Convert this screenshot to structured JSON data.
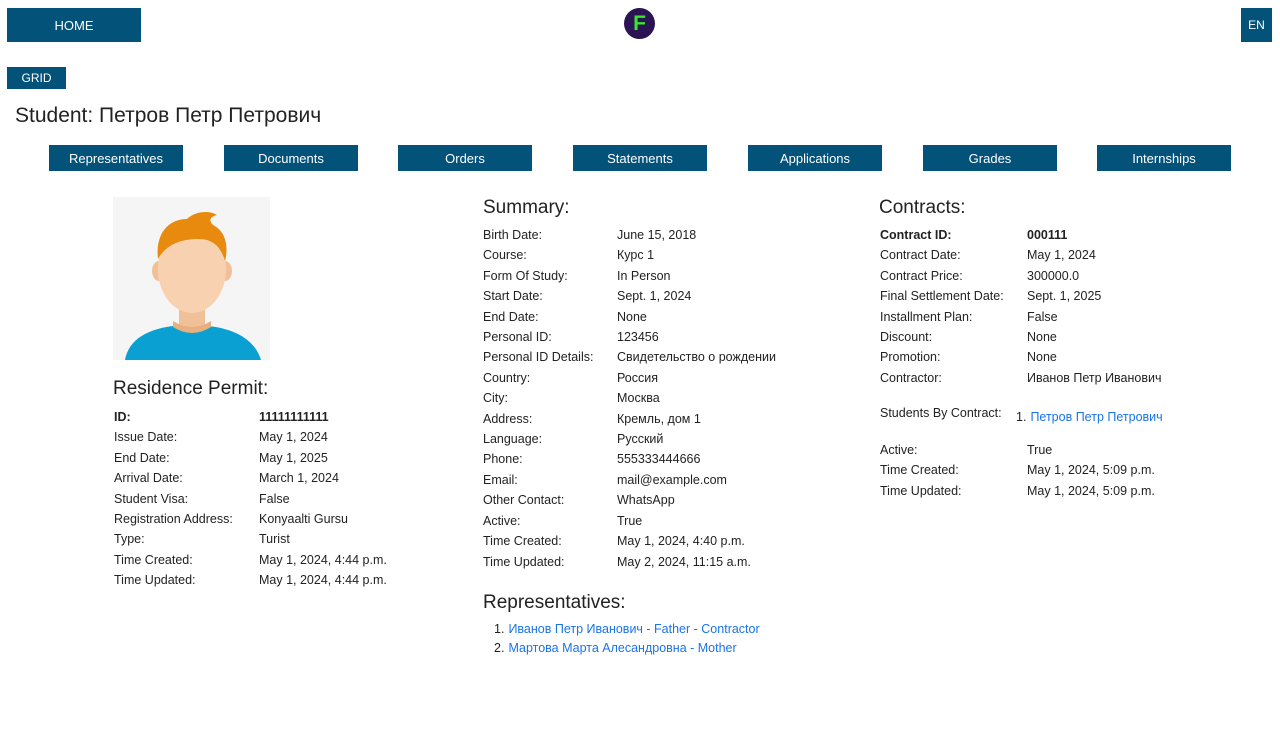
{
  "nav": {
    "home_label": "HOME",
    "logo_letter": "F",
    "lang_label": "EN",
    "grid_label": "GRID"
  },
  "page_title": "Student: Петров Петр Петрович",
  "tabs": [
    "Representatives",
    "Documents",
    "Orders",
    "Statements",
    "Applications",
    "Grades",
    "Internships"
  ],
  "residence": {
    "title": "Residence Permit:",
    "rows": [
      {
        "k": "ID:",
        "v": "11111111111"
      },
      {
        "k": "Issue Date:",
        "v": "May 1, 2024"
      },
      {
        "k": "End Date:",
        "v": "May 1, 2025"
      },
      {
        "k": "Arrival Date:",
        "v": "March 1, 2024"
      },
      {
        "k": "Student Visa:",
        "v": "False"
      },
      {
        "k": "Registration Address:",
        "v": "Konyaalti Gursu"
      },
      {
        "k": "Type:",
        "v": "Turist"
      },
      {
        "k": "Time Created:",
        "v": "May 1, 2024, 4:44 p.m."
      },
      {
        "k": "Time Updated:",
        "v": "May 1, 2024, 4:44 p.m."
      }
    ]
  },
  "summary": {
    "title": "Summary:",
    "rows": [
      {
        "k": "Birth Date:",
        "v": "June 15, 2018"
      },
      {
        "k": "Course:",
        "v": "Курс 1"
      },
      {
        "k": "Form Of Study:",
        "v": "In Person"
      },
      {
        "k": "Start Date:",
        "v": "Sept. 1, 2024"
      },
      {
        "k": "End Date:",
        "v": "None"
      },
      {
        "k": "Personal ID:",
        "v": "123456"
      },
      {
        "k": "Personal ID Details:",
        "v": "Свидетельство о рождении"
      },
      {
        "k": "Country:",
        "v": "Россия"
      },
      {
        "k": "City:",
        "v": "Москва"
      },
      {
        "k": "Address:",
        "v": "Кремль, дом 1"
      },
      {
        "k": "Language:",
        "v": "Русский"
      },
      {
        "k": "Phone:",
        "v": "555333444666"
      },
      {
        "k": "Email:",
        "v": "mail@example.com"
      },
      {
        "k": "Other Contact:",
        "v": "WhatsApp"
      },
      {
        "k": "Active:",
        "v": "True"
      },
      {
        "k": "Time Created:",
        "v": "May 1, 2024, 4:40 p.m."
      },
      {
        "k": "Time Updated:",
        "v": "May 2, 2024, 11:15 a.m."
      }
    ]
  },
  "representatives": {
    "title": "Representatives:",
    "items": [
      {
        "num": "1.",
        "label": "Иванов Петр Иванович - Father - Contractor"
      },
      {
        "num": "2.",
        "label": "Мартова Марта Алесандровна - Mother"
      }
    ]
  },
  "contracts": {
    "title": "Contracts:",
    "rows": [
      {
        "k": "Contract ID:",
        "v": "000111"
      },
      {
        "k": "Contract Date:",
        "v": "May 1, 2024"
      },
      {
        "k": "Contract Price:",
        "v": "300000.0"
      },
      {
        "k": "Final Settlement Date:",
        "v": "Sept. 1, 2025"
      },
      {
        "k": "Installment Plan:",
        "v": "False"
      },
      {
        "k": "Discount:",
        "v": "None"
      },
      {
        "k": "Promotion:",
        "v": "None"
      },
      {
        "k": "Contractor:",
        "v": "Иванов Петр Иванович"
      }
    ],
    "students_label": "Students By Contract:",
    "students": [
      {
        "num": "1.",
        "label": "Петров Петр Петрович"
      }
    ],
    "rows2": [
      {
        "k": "Active:",
        "v": "True"
      },
      {
        "k": "Time Created:",
        "v": "May 1, 2024, 5:09 p.m."
      },
      {
        "k": "Time Updated:",
        "v": "May 1, 2024, 5:09 p.m."
      }
    ]
  },
  "colors": {
    "primary": "#03527a",
    "link": "#1a73e8",
    "logo_bg": "#2c1454",
    "logo_fg": "#39e62e"
  },
  "icons": {
    "avatar": "user-avatar-icon"
  }
}
